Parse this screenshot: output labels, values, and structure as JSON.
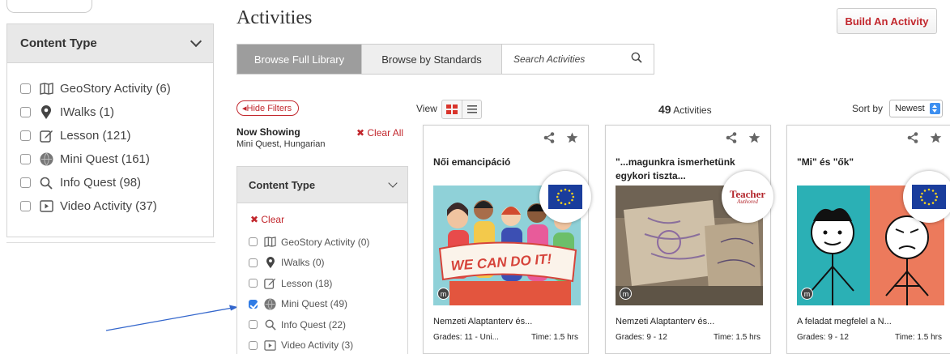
{
  "background_filter": {
    "title": "Content Type",
    "items": [
      {
        "label": "GeoStory Activity (6)",
        "icon": "map-icon"
      },
      {
        "label": "IWalks (1)",
        "icon": "location-pin-icon"
      },
      {
        "label": "Lesson (121)",
        "icon": "edit-icon"
      },
      {
        "label": "Mini Quest (161)",
        "icon": "globe-icon"
      },
      {
        "label": "Info Quest (98)",
        "icon": "search-icon"
      },
      {
        "label": "Video Activity (37)",
        "icon": "video-icon"
      }
    ]
  },
  "header": {
    "title": "Activities",
    "build_button": "Build An Activity",
    "tabs": [
      "Browse Full Library",
      "Browse by Standards"
    ],
    "search_placeholder": "Search Activities"
  },
  "filters": {
    "hide_label": "◂Hide Filters",
    "now_showing_label": "Now Showing",
    "now_showing_value": "Mini Quest, Hungarian",
    "clear_all": "✖ Clear All",
    "panel_title": "Content Type",
    "clear": "✖ Clear",
    "items": [
      {
        "label": "GeoStory Activity (0)",
        "icon": "map-icon",
        "checked": false
      },
      {
        "label": "IWalks (0)",
        "icon": "location-pin-icon",
        "checked": false
      },
      {
        "label": "Lesson (18)",
        "icon": "edit-icon",
        "checked": false
      },
      {
        "label": "Mini Quest (49)",
        "icon": "globe-icon",
        "checked": true
      },
      {
        "label": "Info Quest (22)",
        "icon": "search-icon",
        "checked": false
      },
      {
        "label": "Video Activity (3)",
        "icon": "video-icon",
        "checked": false
      }
    ]
  },
  "results": {
    "view_label": "View",
    "count": "49",
    "count_label": "Activities",
    "sort_label": "Sort by",
    "sort_value": "Newest"
  },
  "cards": [
    {
      "title": "Női emancipáció",
      "badge": "eu-flag",
      "standards": "Nemzeti Alaptanterv és...",
      "grades": "Grades: 11 - Uni...",
      "time": "Time: 1.5 hrs",
      "banner_text": "WE CAN DO IT!"
    },
    {
      "title": "\"...magunkra ismerhetünk egykori tiszta...",
      "badge": "teacher-authored",
      "badge_text_1": "Teacher",
      "badge_text_2": "Authored",
      "standards": "Nemzeti Alaptanterv és...",
      "grades": "Grades: 9 - 12",
      "time": "Time: 1.5 hrs"
    },
    {
      "title": "\"Mi\" és \"ők\"",
      "badge": "eu-flag",
      "standards": "A feladat megfelel a N...",
      "grades": "Grades: 9 - 12",
      "time": "Time: 1.5 hrs"
    }
  ],
  "colors": {
    "accent_red": "#c2272d",
    "arrow_blue": "#3366cc",
    "check_blue": "#2f7be5"
  }
}
